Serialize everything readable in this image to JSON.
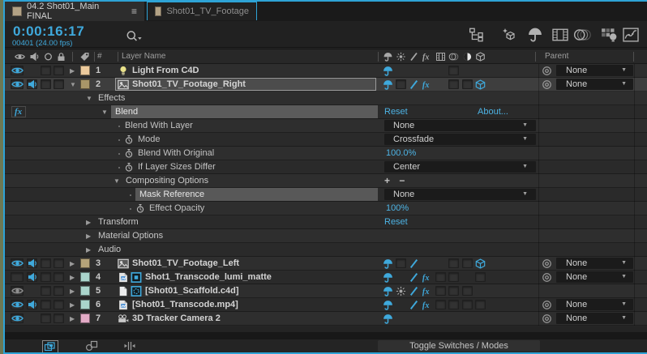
{
  "colors": {
    "accent": "#2ea3d6",
    "cyan_text": "#4db3e4",
    "selection": "#4c4c4c",
    "highlight_bar": "#5b5b5b"
  },
  "tabs": [
    {
      "label": "04.2 Shot01_Main FINAL",
      "active": true,
      "icon": "comp-icon",
      "menu_icon": "panel-menu-icon"
    },
    {
      "label": "Shot01_TV_Footage",
      "active": false,
      "icon": "comp-icon"
    }
  ],
  "toolbar": {
    "timecode": "0:00:16:17",
    "frame_info": "00401 (24.00 fps)",
    "search_icon": "search-icon",
    "icons": [
      "mini-flowchart-icon",
      "draft-3d-icon",
      "shy-layers-icon",
      "frame-blend-icon",
      "motion-blur-icon",
      "brainstorm-icon",
      "graph-editor-icon"
    ]
  },
  "header": {
    "av_icons": [
      "eye-icon",
      "audio-icon",
      "solo-icon",
      "lock-icon"
    ],
    "label_icon": "tag-icon",
    "num_label": "#",
    "name_label": "Layer Name",
    "switch_icons": [
      "shy-icon",
      "collapse-icon",
      "quality-icon",
      "fx-icon",
      "film-icon",
      "motion-blur-sm-icon",
      "adjustment-icon",
      "cube-icon"
    ],
    "parent_label": "Parent"
  },
  "rows": [
    {
      "type": "layer",
      "num": "1",
      "name": "Light From C4D",
      "icons": [
        "lightbulb-icon"
      ],
      "color": "#ecca9c",
      "eye": "on",
      "audio": "none",
      "arrow": "collapsed",
      "selected": false,
      "switches": {
        "0": "shy-icon"
      },
      "cells": [
        5
      ],
      "parent": "None"
    },
    {
      "type": "layer",
      "num": "2",
      "name": "Shot01_TV_Footage_Right",
      "icons": [
        "footage-icon"
      ],
      "color": "#a89668",
      "eye": "on",
      "audio": "on",
      "arrow": "expanded",
      "selected": true,
      "switches": {
        "0": "shy-icon",
        "2": "quality-icon",
        "3": "fx-icon",
        "7": "cube-icon"
      },
      "cells": [
        1,
        5,
        6
      ],
      "parent": "None"
    },
    {
      "type": "group",
      "label": "Effects",
      "indent": "L1",
      "arrow": "expanded"
    },
    {
      "type": "effect",
      "label": "Blend",
      "indent": "L2",
      "arrow": "expanded",
      "gutter": "fx-icon",
      "highlighted": true,
      "links": [
        "Reset",
        "About..."
      ]
    },
    {
      "type": "prop",
      "label": "Blend With Layer",
      "indent": "L3",
      "stopwatch": false,
      "value": {
        "kind": "dropdown",
        "text": "None"
      }
    },
    {
      "type": "prop",
      "label": "Mode",
      "indent": "L3",
      "stopwatch": true,
      "value": {
        "kind": "dropdown",
        "text": "Crossfade"
      }
    },
    {
      "type": "prop",
      "label": "Blend With Original",
      "indent": "L3",
      "stopwatch": true,
      "value": {
        "kind": "number",
        "text": "100.0%"
      }
    },
    {
      "type": "prop",
      "label": "If Layer Sizes Differ",
      "indent": "L3",
      "stopwatch": true,
      "value": {
        "kind": "dropdown",
        "text": "Center"
      }
    },
    {
      "type": "group",
      "label": "Compositing Options",
      "indent": "CO",
      "arrow": "expanded",
      "value": {
        "kind": "plusminus",
        "text": "+ −"
      }
    },
    {
      "type": "prop",
      "label": "Mask Reference",
      "indent": "L4",
      "stopwatch": false,
      "highlighted": true,
      "value": {
        "kind": "dropdown",
        "text": "None"
      }
    },
    {
      "type": "prop",
      "label": "Effect Opacity",
      "indent": "L4",
      "stopwatch": true,
      "value": {
        "kind": "number",
        "text": "100%"
      }
    },
    {
      "type": "group",
      "label": "Transform",
      "indent": "L1",
      "arrow": "collapsed",
      "value": {
        "kind": "link",
        "text": "Reset"
      }
    },
    {
      "type": "group",
      "label": "Material Options",
      "indent": "L1",
      "arrow": "collapsed"
    },
    {
      "type": "group",
      "label": "Audio",
      "indent": "L1",
      "arrow": "collapsed"
    },
    {
      "type": "layer",
      "num": "3",
      "name": "Shot01_TV_Footage_Left",
      "icons": [
        "footage-icon"
      ],
      "color": "#b5a379",
      "eye": "on",
      "audio": "on",
      "arrow": "collapsed",
      "selected": false,
      "switches": {
        "0": "shy-icon",
        "2": "quality-icon",
        "7": "cube-icon"
      },
      "cells": [
        1,
        5,
        6
      ],
      "parent": "None"
    },
    {
      "type": "layer",
      "num": "4",
      "name": "Shot1_Transcode_lumi_matte",
      "icons": [
        "file-icon",
        "matte-icon"
      ],
      "color": "#a9d4cb",
      "eye": "off",
      "audio": "on",
      "arrow": "collapsed",
      "selected": false,
      "switches": {
        "0": "shy-icon",
        "2": "quality-icon",
        "3": "fx-icon"
      },
      "cells": [
        4,
        5,
        7
      ],
      "parent": "None"
    },
    {
      "type": "layer",
      "num": "5",
      "name": "[Shot01_Scaffold.c4d]",
      "icons": [
        "page-icon",
        "c4d-icon"
      ],
      "color": "#a9d4cb",
      "eye": "dim",
      "audio": "none",
      "arrow": "collapsed",
      "selected": false,
      "switches": {
        "0": "shy-icon",
        "1": "collapse-icon-dim",
        "2": "quality-icon",
        "3": "fx-icon"
      },
      "cells": [
        4,
        5,
        6
      ],
      "parent": null
    },
    {
      "type": "layer",
      "num": "6",
      "name": "[Shot01_Transcode.mp4]",
      "icons": [
        "file-icon"
      ],
      "color": "#a9d4cb",
      "eye": "on",
      "audio": "on",
      "arrow": "collapsed",
      "selected": false,
      "switches": {
        "0": "shy-icon",
        "2": "quality-icon",
        "3": "fx-icon"
      },
      "cells": [
        4,
        5,
        6,
        7
      ],
      "parent": "None"
    },
    {
      "type": "layer",
      "num": "7",
      "name": "3D Tracker Camera 2",
      "icons": [
        "camera-icon"
      ],
      "color": "#e3aac6",
      "eye": "on",
      "audio": "none",
      "arrow": "collapsed",
      "selected": false,
      "switches": {
        "0": "shy-icon"
      },
      "cells": [],
      "parent": "None"
    }
  ],
  "bottom": {
    "icons": [
      "layer-switches-pane-icon",
      "transfer-controls-pane-icon",
      "inout-panes-icon"
    ],
    "toggle_label": "Toggle Switches / Modes"
  }
}
